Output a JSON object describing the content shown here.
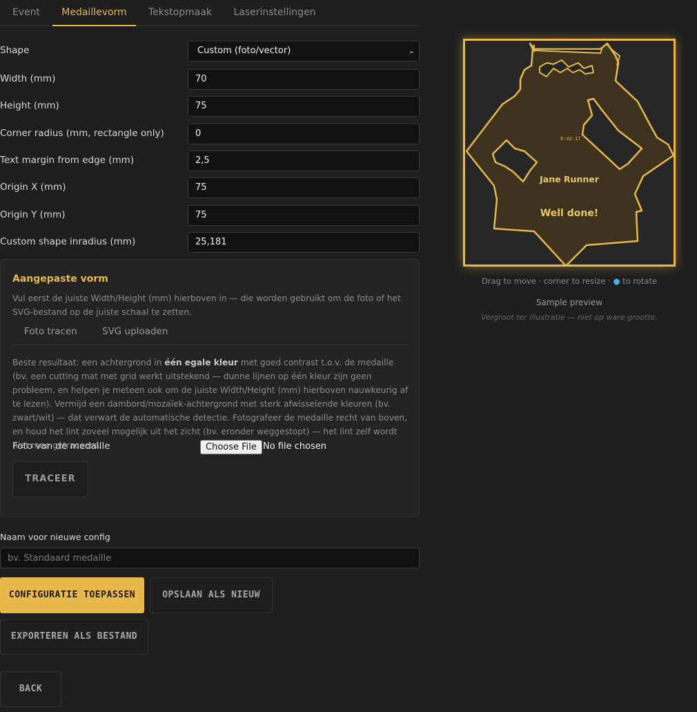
{
  "tabs": [
    {
      "label": "Event"
    },
    {
      "label": "Medaillevorm"
    },
    {
      "label": "Tekstopmaak"
    },
    {
      "label": "Laserinstellingen"
    }
  ],
  "form": {
    "shape": {
      "label": "Shape",
      "value": "Custom (foto/vector)"
    },
    "width": {
      "label": "Width (mm)",
      "value": "70"
    },
    "height": {
      "label": "Height (mm)",
      "value": "75"
    },
    "corner_radius": {
      "label": "Corner radius (mm, rectangle only)",
      "value": "0"
    },
    "text_margin": {
      "label": "Text margin from edge (mm)",
      "value": "2,5"
    },
    "origin_x": {
      "label": "Origin X (mm)",
      "value": "75"
    },
    "origin_y": {
      "label": "Origin Y (mm)",
      "value": "75"
    },
    "inradius": {
      "label": "Custom shape inradius (mm)",
      "value": "25,181"
    }
  },
  "custom_panel": {
    "title": "Aangepaste vorm",
    "intro": "Vul eerst de juiste Width/Height (mm) hierboven in — die worden gebruikt om de foto of het SVG-bestand op de juiste schaal te zetten.",
    "subtabs": [
      "Foto tracen",
      "SVG uploaden"
    ],
    "help_1": "Beste resultaat: een achtergrond in ",
    "help_bold": "één egale kleur",
    "help_2": " met goed contrast t.o.v. de medaille (bv. een cutting mat met grid werkt uitstekend — dunne lijnen op één kleur zijn geen probleem, en helpen je meteen ook om de juiste Width/Height (mm) hierboven nauwkeurig af te lezen). Vermijd een dambord/mozaïek-achtergrond met sterk afwisselende kleuren (bv. zwart/wit) — dat verwart de automatische detectie. Fotografeer de medaille recht van boven, en houd het lint zoveel mogelijk uit het zicht (bv. eronder weggestopt) — het lint zelf wordt niet mee getraceerd.",
    "photo_label": "Foto van de medaille",
    "file_button": "Choose File",
    "file_status": "No file chosen",
    "trace_button": "TRACEER"
  },
  "config": {
    "name_label": "Naam voor nieuwe config",
    "name_placeholder": "bv. Standaard medaille",
    "apply_button": "CONFIGURATIE TOEPASSEN",
    "save_new_button": "OPSLAAN ALS NIEUW",
    "export_button": "EXPORTEREN ALS BESTAND",
    "back_button": "BACK"
  },
  "preview": {
    "time_text": "0:42:17",
    "name_text": "Jane Runner",
    "message_text": "Well done!",
    "hint_1": "Drag to move · corner to resize · ",
    "hint_dot": "●",
    "hint_2": " to rotate",
    "sample_label": "Sample preview",
    "scale_note": "Vergroot ter illustratie — niet op ware grootte."
  },
  "colors": {
    "accent": "#e8b84a",
    "background": "#1e1e1e",
    "rotate_handle": "#3fb5e8"
  }
}
